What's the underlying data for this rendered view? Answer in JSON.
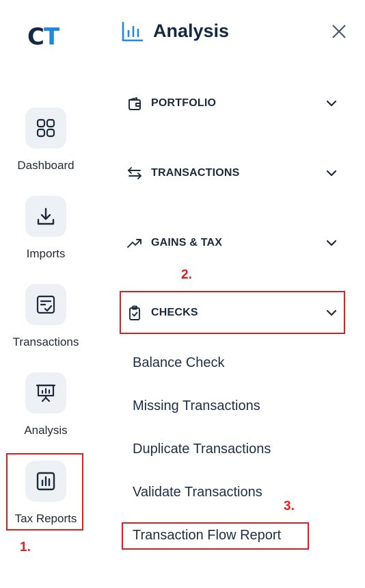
{
  "logo": {
    "c": "C",
    "t": "T"
  },
  "nav": {
    "items": [
      {
        "label": "Dashboard",
        "icon": "dashboard-grid-icon"
      },
      {
        "label": "Imports",
        "icon": "download-icon"
      },
      {
        "label": "Transactions",
        "icon": "checklist-icon"
      },
      {
        "label": "Analysis",
        "icon": "presentation-chart-icon"
      },
      {
        "label": "Tax Reports",
        "icon": "bar-report-icon"
      }
    ]
  },
  "panel": {
    "title": "Analysis",
    "sections": [
      {
        "label": "PORTFOLIO",
        "icon": "wallet-icon"
      },
      {
        "label": "TRANSACTIONS",
        "icon": "swap-arrows-icon"
      },
      {
        "label": "GAINS & TAX",
        "icon": "trend-up-icon"
      },
      {
        "label": "CHECKS",
        "icon": "clipboard-check-icon"
      }
    ],
    "check_items": [
      "Balance Check",
      "Missing Transactions",
      "Duplicate Transactions",
      "Validate Transactions",
      "Transaction Flow Report"
    ]
  },
  "annotations": {
    "step1": "1.",
    "step2": "2.",
    "step3": "3."
  },
  "colors": {
    "brand_dark": "#142a44",
    "brand_accent": "#1e88e5",
    "highlight": "#e01e1e"
  }
}
